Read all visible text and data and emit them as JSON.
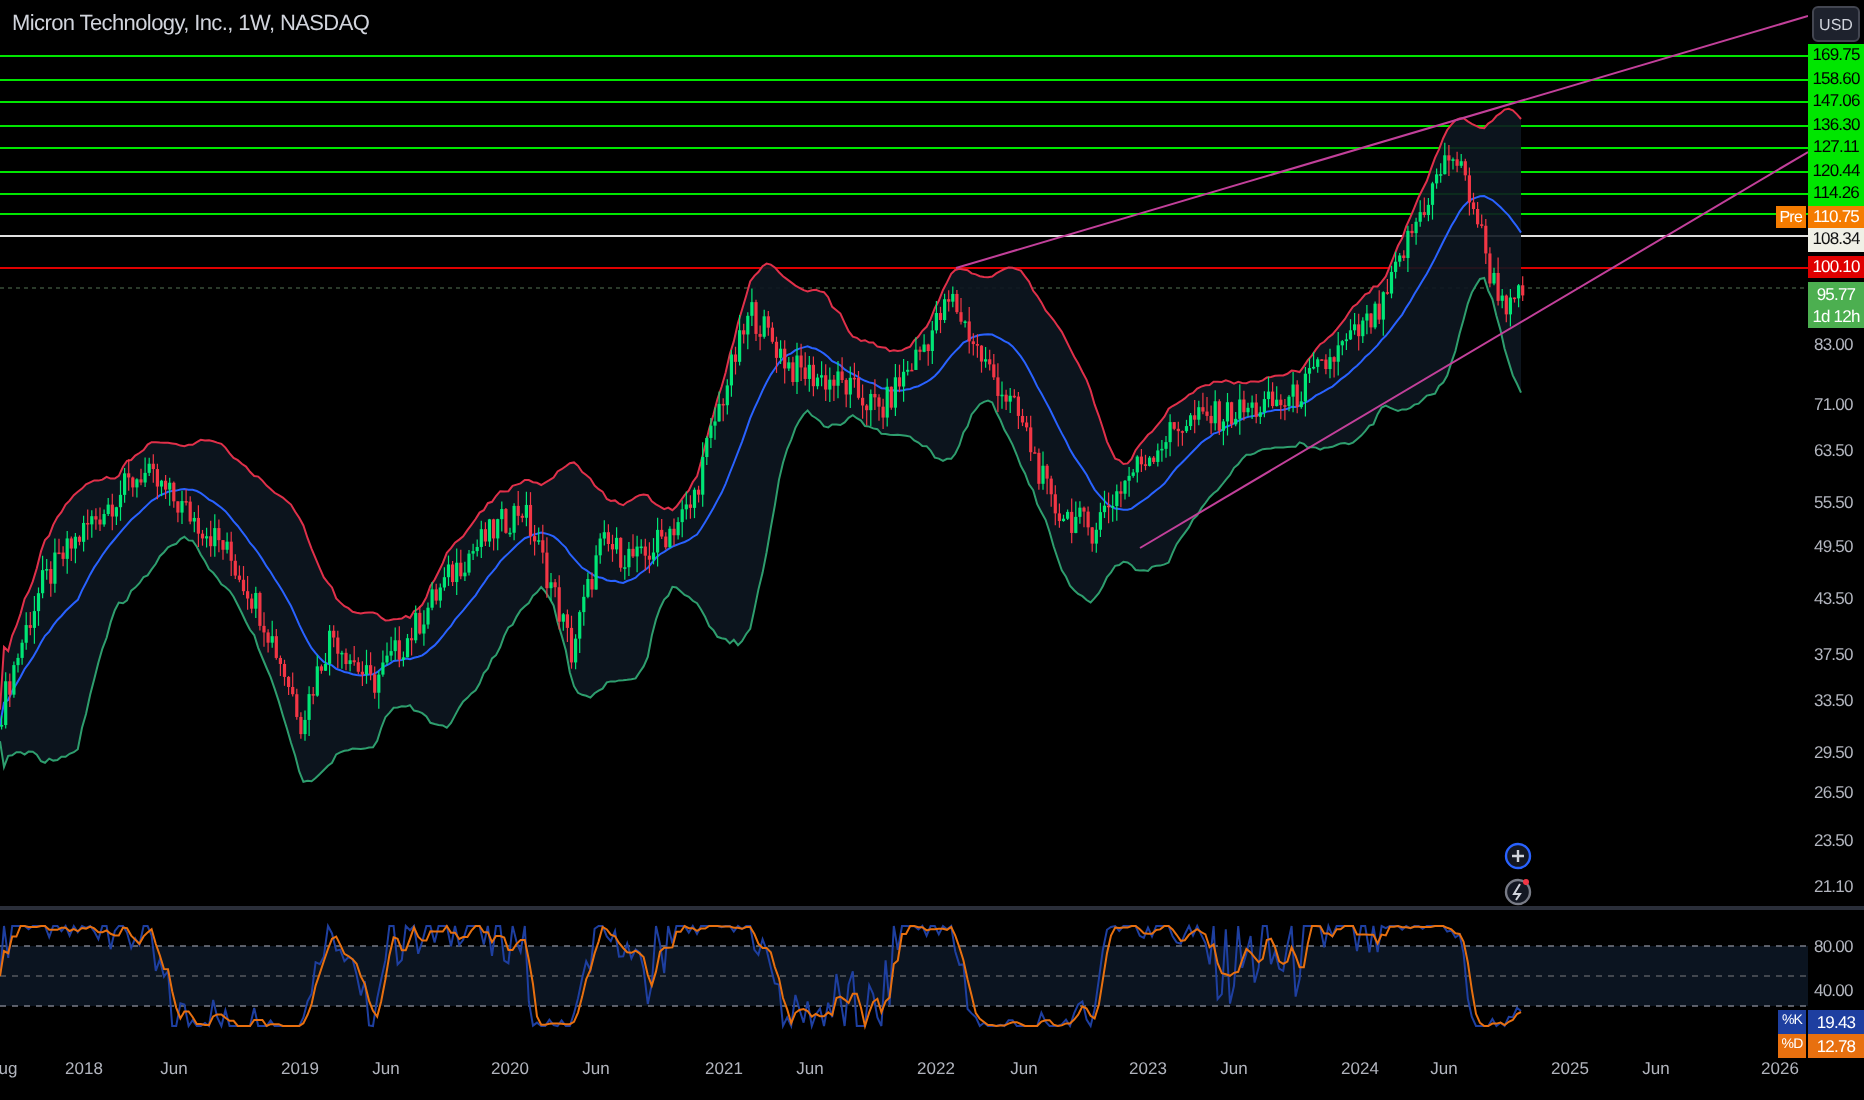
{
  "chart": {
    "title": "Micron Technology, Inc., 1W, NASDAQ",
    "currency_button": "USD",
    "price_badges": [
      {
        "kind": "level",
        "text": "169.75"
      },
      {
        "kind": "level",
        "text": "158.60"
      },
      {
        "kind": "level",
        "text": "147.06"
      },
      {
        "kind": "level",
        "text": "136.30"
      },
      {
        "kind": "level",
        "text": "127.11"
      },
      {
        "kind": "level",
        "text": "120.44"
      },
      {
        "kind": "level",
        "text": "114.26"
      },
      {
        "kind": "premarket",
        "tag": "Pre",
        "text": "110.75"
      },
      {
        "kind": "marker",
        "text": "108.34"
      },
      {
        "kind": "alert",
        "text": "100.10"
      },
      {
        "kind": "last",
        "text": "95.77",
        "countdown": "1d 12h"
      }
    ],
    "price_ticks": [
      "83.00",
      "71.00",
      "63.50",
      "55.50",
      "49.50",
      "43.50",
      "37.50",
      "33.50",
      "29.50",
      "26.50",
      "23.50",
      "21.10"
    ],
    "oscillator": {
      "ticks": [
        "80.00",
        "40.00"
      ],
      "badges": [
        {
          "label": "%K",
          "value": "19.43",
          "color": "#1e3fa0"
        },
        {
          "label": "%D",
          "value": "12.78",
          "color": "#e8700f"
        }
      ]
    },
    "time_axis": [
      "ug",
      "2018",
      "Jun",
      "2019",
      "Jun",
      "2020",
      "Jun",
      "2021",
      "Jun",
      "2022",
      "Jun",
      "2023",
      "Jun",
      "2024",
      "Jun",
      "2025",
      "Jun",
      "2026"
    ]
  }
}
